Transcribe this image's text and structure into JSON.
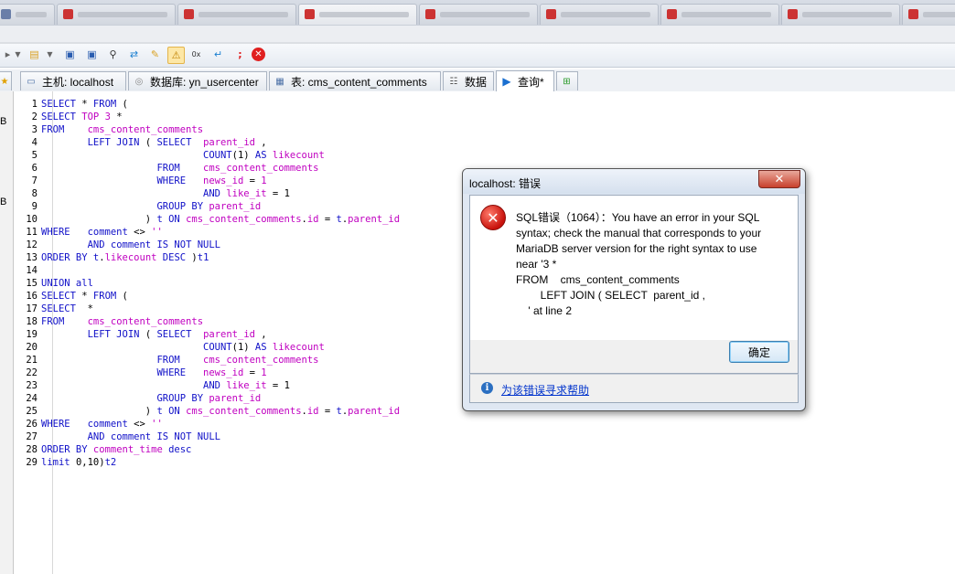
{
  "tabs": [
    {
      "label": "主机: localhost",
      "icon": "server-icon"
    },
    {
      "label": "数据库: yn_usercenter",
      "icon": "database-icon"
    },
    {
      "label": "表: cms_content_comments",
      "icon": "table-icon"
    },
    {
      "label": "数据",
      "icon": "data-grid-icon"
    },
    {
      "label": "查询*",
      "icon": "play-query-icon"
    }
  ],
  "left_panel": [
    "B",
    "B"
  ],
  "editor": {
    "line_numbers": [
      "1",
      "2",
      "3",
      "4",
      "5",
      "6",
      "7",
      "8",
      "9",
      "10",
      "11",
      "12",
      "13",
      "14",
      "15",
      "16",
      "17",
      "18",
      "19",
      "20",
      "21",
      "22",
      "23",
      "24",
      "25",
      "26",
      "27",
      "28",
      "29"
    ]
  },
  "dialog": {
    "title": "localhost: 错误",
    "close_label": "✕",
    "message_lines": [
      "SQL错误（1064）：You have an error in your SQL",
      "syntax; check the manual that corresponds to your",
      "MariaDB server version for the right syntax to use",
      "near '3 *",
      "FROM    cms_content_comments",
      "        LEFT JOIN ( SELECT  parent_id ,",
      "    ' at line 2"
    ],
    "ok_label": "确定",
    "help_link": "为该错误寻求帮助"
  }
}
